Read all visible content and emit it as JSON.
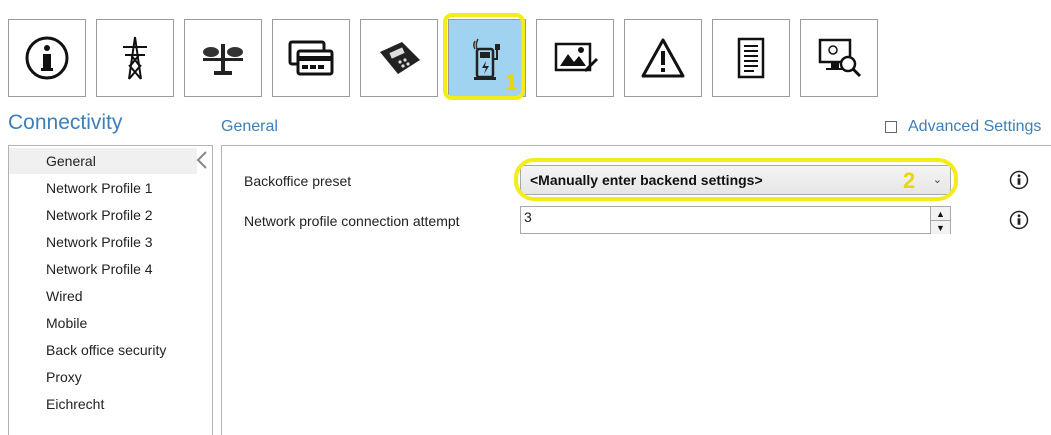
{
  "toolbar": {
    "buttons": [
      {
        "icon": "info-circle-icon",
        "active": false
      },
      {
        "icon": "power-tower-icon",
        "active": false
      },
      {
        "icon": "balance-scale-icon",
        "active": false
      },
      {
        "icon": "payment-cards-icon",
        "active": false
      },
      {
        "icon": "card-terminal-icon",
        "active": false
      },
      {
        "icon": "ev-charger-connectivity-icon",
        "active": true
      },
      {
        "icon": "image-edit-icon",
        "active": false
      },
      {
        "icon": "warning-icon",
        "active": false
      },
      {
        "icon": "document-icon",
        "active": false
      },
      {
        "icon": "monitor-search-icon",
        "active": false
      }
    ],
    "accent_active": "#9fd3ef"
  },
  "annotations": {
    "marker1": "1",
    "marker2": "2",
    "color": "#f2ec19"
  },
  "header": {
    "section_title": "Connectivity",
    "subsection_title": "General",
    "advanced_settings_label": "Advanced Settings",
    "advanced_settings_checked": false
  },
  "sidebar": {
    "items": [
      {
        "label": "General",
        "selected": true
      },
      {
        "label": "Network Profile 1",
        "selected": false
      },
      {
        "label": "Network Profile 2",
        "selected": false
      },
      {
        "label": "Network Profile 3",
        "selected": false
      },
      {
        "label": "Network Profile 4",
        "selected": false
      },
      {
        "label": "Wired",
        "selected": false
      },
      {
        "label": "Mobile",
        "selected": false
      },
      {
        "label": "Back office security",
        "selected": false
      },
      {
        "label": "Proxy",
        "selected": false
      },
      {
        "label": "Eichrecht",
        "selected": false
      }
    ]
  },
  "form": {
    "backoffice_preset_label": "Backoffice preset",
    "backoffice_preset_value": "<Manually enter backend settings>",
    "connection_attempt_label": "Network profile connection attempt",
    "connection_attempt_value": "3"
  },
  "colors": {
    "title_blue": "#3d7fb8"
  }
}
